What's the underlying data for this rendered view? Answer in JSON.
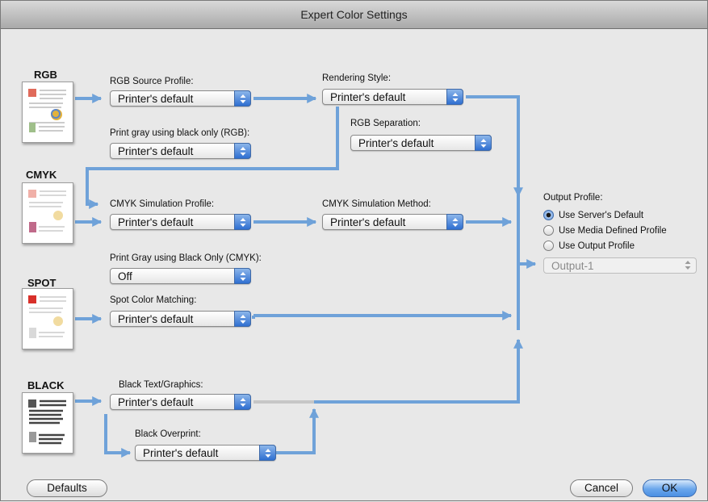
{
  "window": {
    "title": "Expert Color Settings"
  },
  "sections": {
    "rgb": "RGB",
    "cmyk": "CMYK",
    "spot": "SPOT",
    "black": "BLACK"
  },
  "thumbnails": [
    "rgb-document-icon",
    "cmyk-document-icon",
    "spot-document-icon",
    "black-document-icon"
  ],
  "controls": {
    "rgb_source": {
      "label": "RGB Source Profile:",
      "value": "Printer's default"
    },
    "rgb_gray": {
      "label": "Print gray using black only (RGB):",
      "value": "Printer's default"
    },
    "rendering": {
      "label": "Rendering Style:",
      "value": "Printer's default"
    },
    "rgb_separation": {
      "label": "RGB Separation:",
      "value": "Printer's default"
    },
    "cmyk_sim_profile": {
      "label": "CMYK Simulation Profile:",
      "value": "Printer's default"
    },
    "cmyk_sim_method": {
      "label": "CMYK Simulation Method:",
      "value": "Printer's default"
    },
    "cmyk_gray": {
      "label": "Print Gray using Black Only (CMYK):",
      "value": "Off"
    },
    "spot_matching": {
      "label": "Spot Color Matching:",
      "value": "Printer's default"
    },
    "black_text": {
      "label": "Black Text/Graphics:",
      "value": "Printer's default"
    },
    "black_overprint": {
      "label": "Black Overprint:",
      "value": "Printer's default"
    }
  },
  "output": {
    "label": "Output Profile:",
    "options": [
      "Use Server's Default",
      "Use Media Defined Profile",
      "Use Output Profile"
    ],
    "selected": "Use Server's Default",
    "profile_value": "Output-1"
  },
  "buttons": {
    "defaults": "Defaults",
    "cancel": "Cancel",
    "ok": "OK"
  },
  "colors": {
    "flow_arrow": "#6fa2d9",
    "disabled_line": "#c6c6c6",
    "popup_arrow": "#3a78d6",
    "default_button": "#5b9be8"
  }
}
